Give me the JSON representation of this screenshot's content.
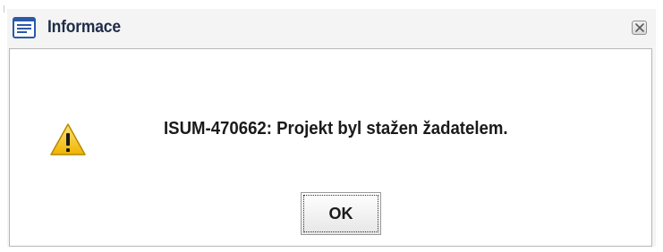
{
  "dialog": {
    "title": "Informace",
    "title_icon": "document-lines-icon",
    "close_icon": "close-icon",
    "warning_icon": "warning-icon",
    "message": "ISUM-470662: Projekt byl stažen žadatelem.",
    "ok_label": "OK"
  },
  "colors": {
    "title_text": "#1f2d49",
    "dialog_bg": "#f4f4f4",
    "content_bg": "#ffffff",
    "warning_yellow": "#f5c400"
  }
}
